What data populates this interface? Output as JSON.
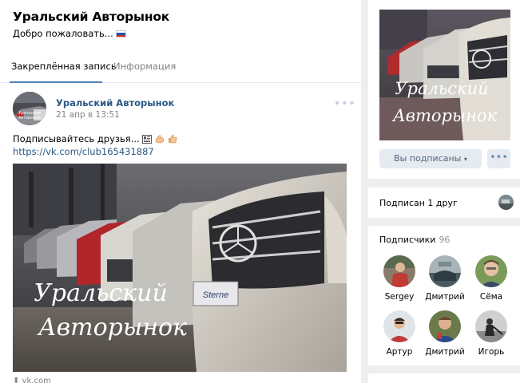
{
  "group": {
    "title": "Уральский Авторынок",
    "status": "Добро пожаловать..."
  },
  "tabs": [
    {
      "label": "Закреплённая запись",
      "active": true
    },
    {
      "label": "Информация",
      "active": false
    }
  ],
  "post": {
    "author": "Уральский Авторынок",
    "date": "21 апр в 13:51",
    "text": "Подписывайтесь друзья...",
    "link": "https://vk.com/club165431887",
    "image_caption_line1": "Уральский",
    "image_caption_line2": "Авторынок",
    "plate_text": "Sterne",
    "source": "vk.com",
    "menu_icon": "more-dots-icon"
  },
  "sidebar": {
    "cover_caption_line1": "Уральский",
    "cover_caption_line2": "Авторынок",
    "subscribed_button": "Вы подписаны",
    "more_icon": "more-dots-icon",
    "friends_label": "Подписан 1 друг",
    "subscribers_label": "Подписчики",
    "subscribers_count": "96",
    "subscribers": [
      {
        "name": "Sergey"
      },
      {
        "name": "Дмитрий"
      },
      {
        "name": "Сёма"
      },
      {
        "name": "Артур"
      },
      {
        "name": "Дмитрий"
      },
      {
        "name": "Игорь"
      }
    ]
  },
  "colors": {
    "accent": "#5181b8",
    "link": "#2a5885",
    "muted": "#828282",
    "button_bg": "#e5ebf1",
    "page_bg": "#edeef0"
  }
}
